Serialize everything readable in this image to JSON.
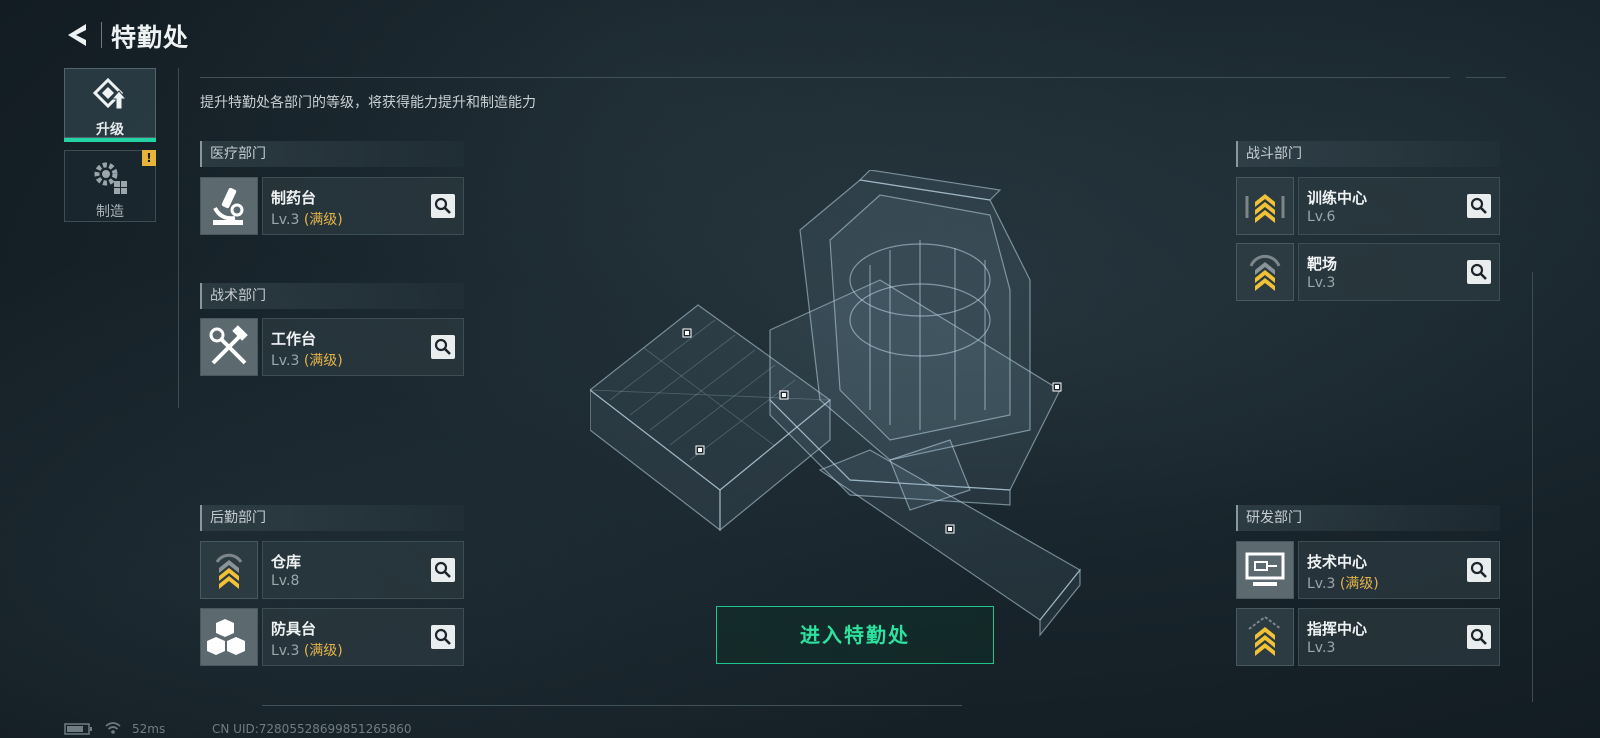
{
  "header": {
    "title": "特勤处"
  },
  "tabs": [
    {
      "label": "升级",
      "icon": "upgrade-icon",
      "active": true
    },
    {
      "label": "制造",
      "icon": "gears-icon",
      "alert": "!"
    }
  ],
  "description": "提升特勤处各部门的等级，将获得能力提升和制造能力",
  "departments": {
    "medical": {
      "title": "医疗部门",
      "items": [
        {
          "name": "制药台",
          "level": "Lv.3",
          "max": "(满级)",
          "icon": "microscope-icon"
        }
      ]
    },
    "tactical": {
      "title": "战术部门",
      "items": [
        {
          "name": "工作台",
          "level": "Lv.3",
          "max": "(满级)",
          "icon": "tools-icon"
        }
      ]
    },
    "logistics": {
      "title": "后勤部门",
      "items": [
        {
          "name": "仓库",
          "level": "Lv.8",
          "icon": "chevrons-icon"
        },
        {
          "name": "防具台",
          "level": "Lv.3",
          "max": "(满级)",
          "icon": "cubes-icon"
        }
      ]
    },
    "combat": {
      "title": "战斗部门",
      "items": [
        {
          "name": "训练中心",
          "level": "Lv.6",
          "icon": "chevrons-icon"
        },
        {
          "name": "靶场",
          "level": "Lv.3",
          "icon": "chevrons-icon"
        }
      ]
    },
    "research": {
      "title": "研发部门",
      "items": [
        {
          "name": "技术中心",
          "level": "Lv.3",
          "max": "(满级)",
          "icon": "monitor-icon"
        },
        {
          "name": "指挥中心",
          "level": "Lv.3",
          "icon": "chevrons-icon"
        }
      ]
    }
  },
  "enter_button": "进入特勤处",
  "status": {
    "ping": "52ms",
    "uid": "CN UID:7280552869985126586​0"
  },
  "colors": {
    "accent": "#22d3a5",
    "gold": "#e3b34a",
    "alert": "#e7b43a"
  }
}
